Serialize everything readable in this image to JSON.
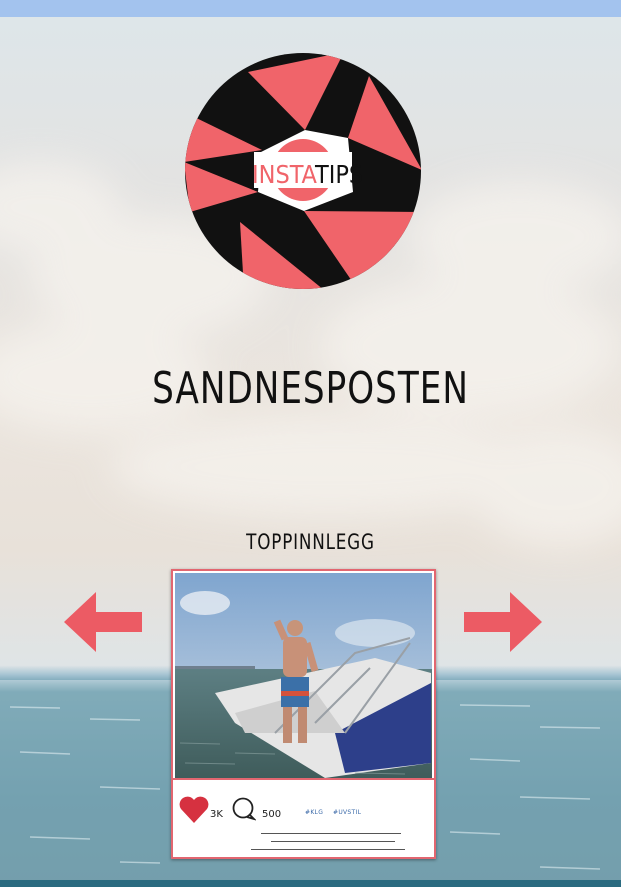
{
  "logo": {
    "word_left": "INSTA",
    "word_right": "TIPS",
    "accent": "#f0646a",
    "dark": "#111111"
  },
  "brand": {
    "title": "SANDNESPOSTEN"
  },
  "section": {
    "title": "TOPPINNLEGG"
  },
  "nav": {
    "prev_icon": "arrow-left-icon",
    "next_icon": "arrow-right-icon",
    "color": "#ec5b64"
  },
  "post": {
    "likes": "3K",
    "comments": "500",
    "hashtags": [
      "#KLG",
      "#UVSTIL"
    ]
  }
}
